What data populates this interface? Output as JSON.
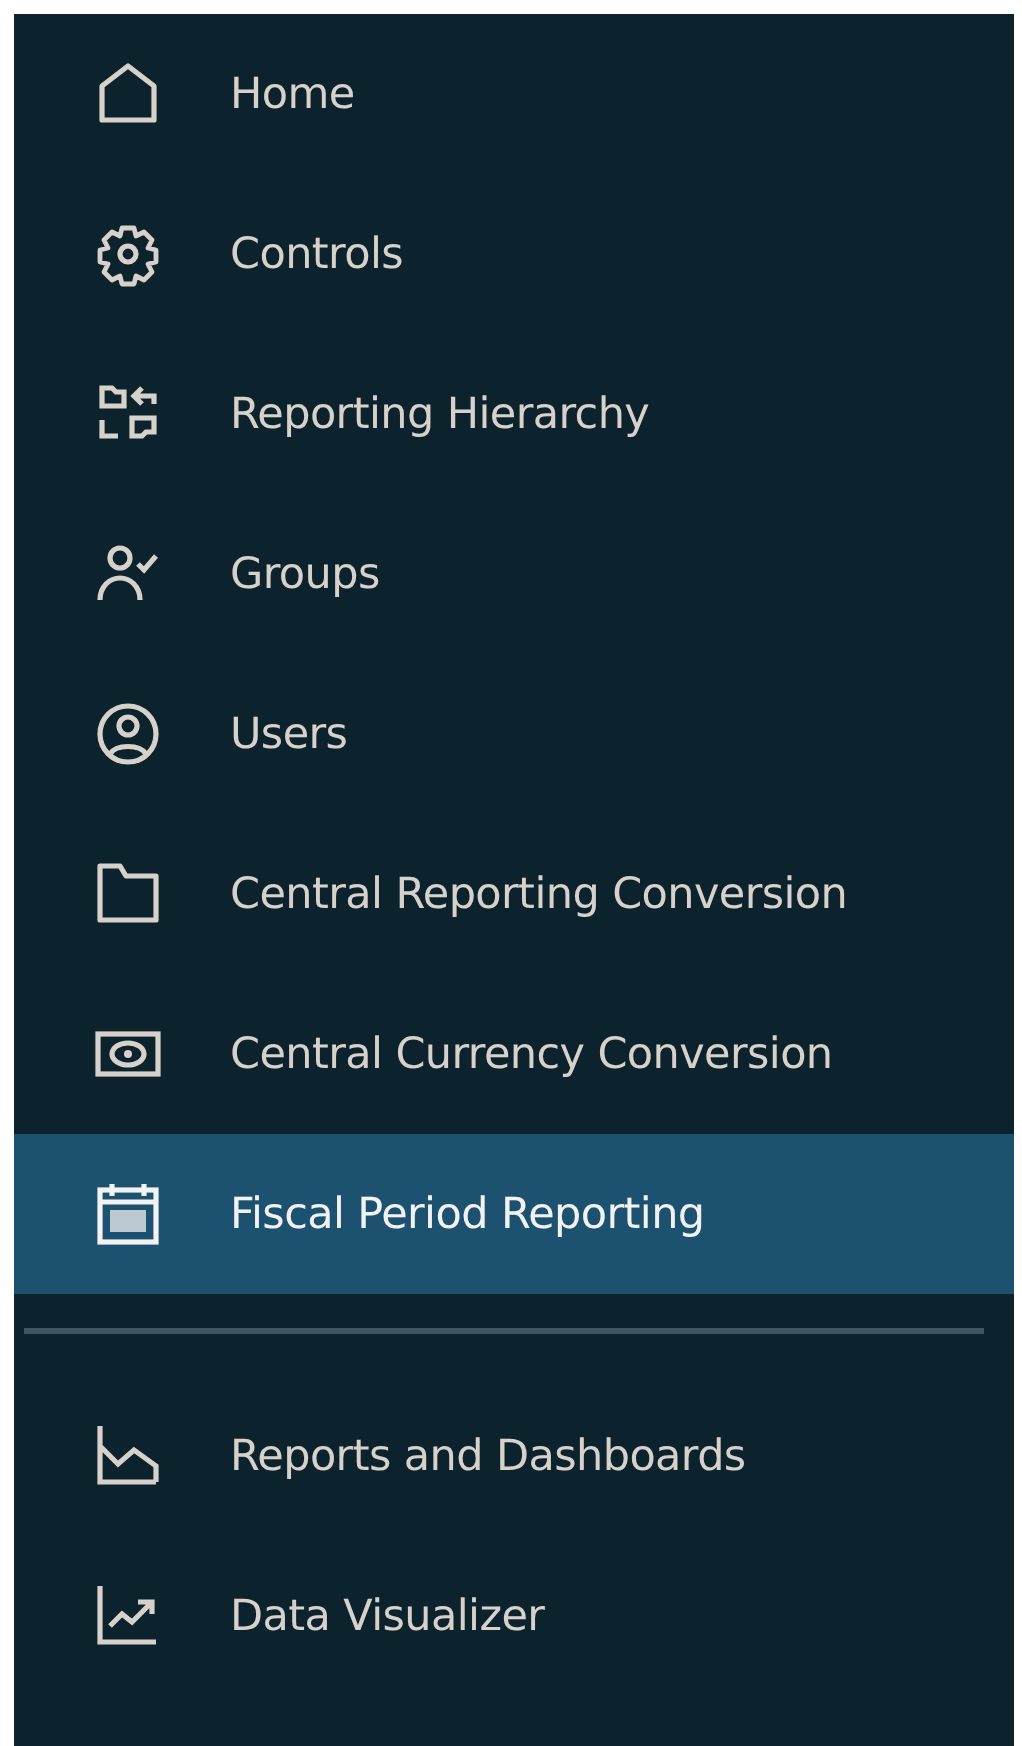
{
  "sidebar": {
    "sections": [
      {
        "items": [
          {
            "label": "Home",
            "selected": false
          },
          {
            "label": "Controls",
            "selected": false
          },
          {
            "label": "Reporting Hierarchy",
            "selected": false
          },
          {
            "label": "Groups",
            "selected": false
          },
          {
            "label": "Users",
            "selected": false
          },
          {
            "label": "Central Reporting Conversion",
            "selected": false
          },
          {
            "label": "Central Currency Conversion",
            "selected": false
          },
          {
            "label": "Fiscal Period Reporting",
            "selected": true
          }
        ]
      },
      {
        "items": [
          {
            "label": "Reports and Dashboards",
            "selected": false
          },
          {
            "label": "Data Visualizer",
            "selected": false
          }
        ]
      }
    ]
  }
}
